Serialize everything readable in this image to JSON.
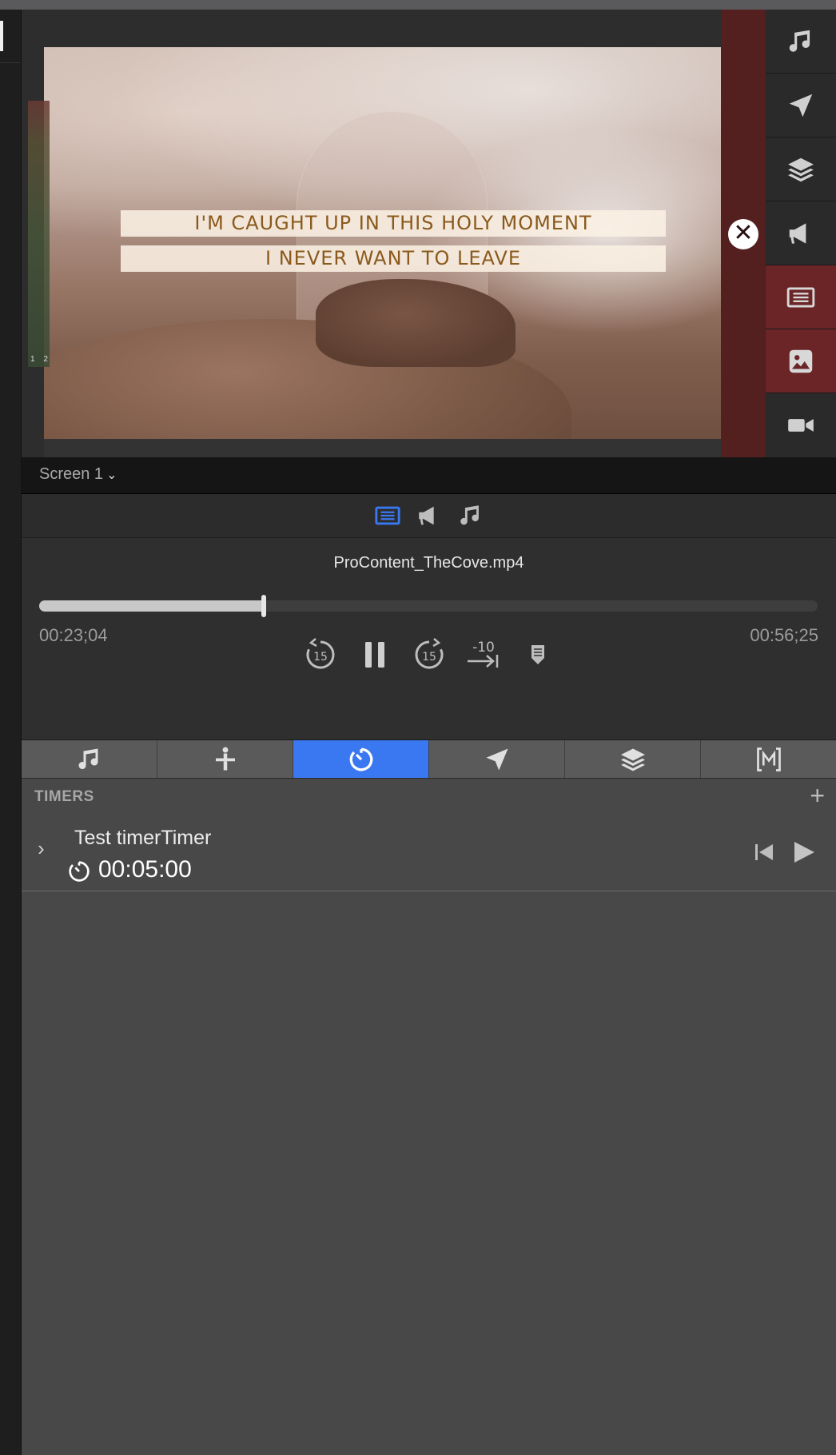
{
  "preview": {
    "lyric_line1": "I'M CAUGHT UP IN THIS HOLY MOMENT",
    "lyric_line2": "I NEVER WANT TO LEAVE",
    "meter_labels": "1 2",
    "close_glyph": "✕"
  },
  "rail": {
    "items": [
      "music-icon",
      "send-icon",
      "layers-icon",
      "megaphone-icon",
      "slide-icon",
      "image-icon",
      "video-camera-icon"
    ],
    "active": [
      "slide-icon",
      "image-icon"
    ]
  },
  "screen": {
    "label": "Screen 1",
    "chevron": "⌄"
  },
  "media_tabs": {
    "items": [
      "slide-icon",
      "megaphone-icon",
      "music-icon"
    ],
    "active": "slide-icon"
  },
  "transport": {
    "filename": "ProContent_TheCove.mp4",
    "elapsed": "00:23;04",
    "total": "00:56;25",
    "progress": 0.289,
    "buttons": [
      "skip-back-15-icon",
      "pause-icon",
      "skip-forward-15-icon",
      "go-to-end-minus-10-icon",
      "marker-icon"
    ],
    "skip_back_label": "15",
    "skip_forward_label": "15",
    "minus10_label": "-10"
  },
  "toolbar": {
    "items": [
      "music-icon",
      "stage-icon",
      "timer-icon",
      "send-icon",
      "layers-icon",
      "macro-icon"
    ],
    "active": "timer-icon"
  },
  "timers": {
    "section_title": "TIMERS",
    "add_label": "+",
    "items": [
      {
        "name": "Test timerTimer",
        "value": "00:05:00",
        "expand_glyph": "›"
      }
    ]
  },
  "colors": {
    "accent_blue": "#3a78f2",
    "active_red": "#6b2527",
    "close_bar": "#541f1f",
    "lyric_text": "#8a5a1c"
  }
}
